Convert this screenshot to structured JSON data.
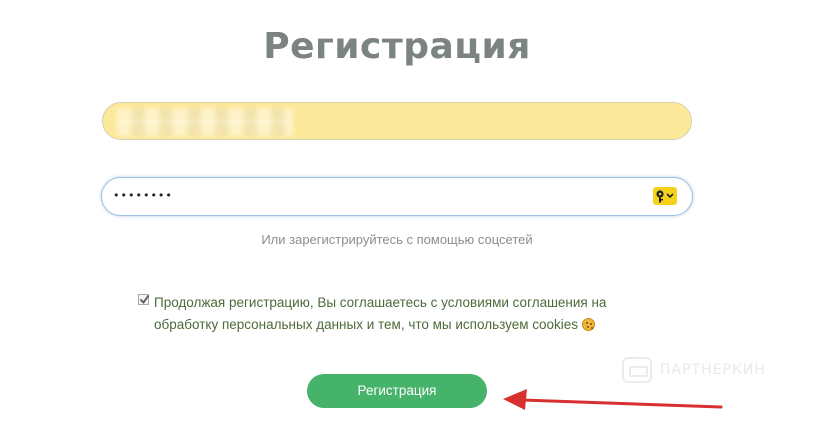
{
  "form": {
    "title": "Регистрация",
    "email_value": "",
    "password_value": "••••••••",
    "social_text": "Или зарегистрируйтесь с помощью соцсетей",
    "agreement_text": "Продолжая регистрацию, Вы соглашаетесь с условиями соглашения на обработку персональных данных и тем, что мы используем cookies",
    "agreement_checked": true,
    "submit_label": "Регистрация"
  },
  "watermark": {
    "text": "ПАРТНЕРКИН"
  },
  "icons": {
    "password_manager": "key-icon",
    "checkbox": "checkmark-icon",
    "cookie": "cookie-icon",
    "annotation": "red-arrow-icon"
  },
  "colors": {
    "title": "#7b8383",
    "email_autofill_bg": "#fde99b",
    "submit_bg": "#45b36a",
    "agreement_text": "#4d6a38",
    "arrow": "#d8302f",
    "key_badge": "#f6d21a"
  }
}
